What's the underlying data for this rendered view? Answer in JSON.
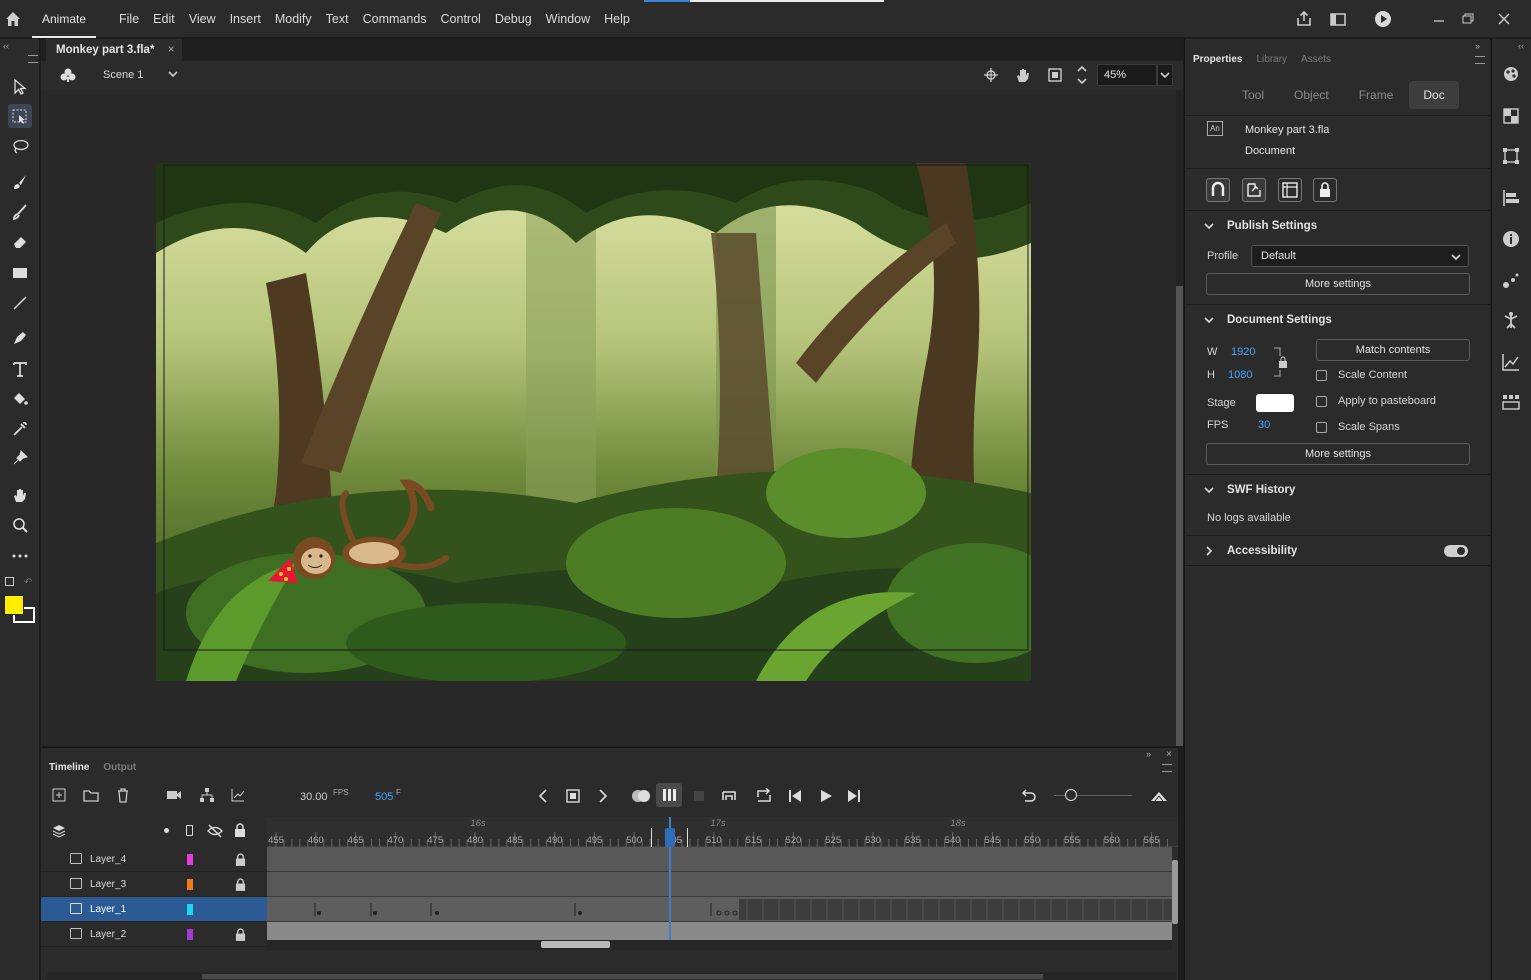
{
  "app": {
    "name": "Animate"
  },
  "menus": [
    "File",
    "Edit",
    "View",
    "Insert",
    "Modify",
    "Text",
    "Commands",
    "Control",
    "Debug",
    "Window",
    "Help"
  ],
  "document": {
    "tab_title": "Monkey part 3.fla*",
    "close": "×"
  },
  "scene": {
    "name": "Scene 1"
  },
  "zoom": {
    "value": "45%"
  },
  "timeline": {
    "tab_timeline": "Timeline",
    "tab_output": "Output",
    "fps_value": "30.00",
    "fps_unit": "FPS",
    "current_frame": "505",
    "frame_unit": "F",
    "ruler_ticks": [
      "455",
      "460",
      "465",
      "470",
      "475",
      "480",
      "485",
      "490",
      "495",
      "500",
      "505",
      "510",
      "515",
      "520",
      "525",
      "530",
      "535",
      "540",
      "545",
      "550",
      "555",
      "560",
      "565"
    ],
    "time_labels": [
      "16s",
      "17s",
      "18s"
    ],
    "layers": [
      {
        "name": "Layer_4",
        "color": "#e03ce0",
        "locked": true
      },
      {
        "name": "Layer_3",
        "color": "#f07a1c",
        "locked": true
      },
      {
        "name": "Layer_1",
        "color": "#1fd6f0",
        "locked": false,
        "selected": true
      },
      {
        "name": "Layer_2",
        "color": "#a03cd0",
        "locked": true
      }
    ]
  },
  "properties": {
    "tabs": [
      "Properties",
      "Library",
      "Assets"
    ],
    "subtabs": [
      "Tool",
      "Object",
      "Frame",
      "Doc"
    ],
    "doc_badge": "An",
    "doc_name": "Monkey part 3.fla",
    "doc_type": "Document",
    "publish": {
      "title": "Publish Settings",
      "profile_label": "Profile",
      "profile_value": "Default",
      "more": "More settings"
    },
    "docsettings": {
      "title": "Document Settings",
      "w_label": "W",
      "w_value": "1920",
      "h_label": "H",
      "h_value": "1080",
      "match": "Match contents",
      "scale_content": "Scale Content",
      "apply_pasteboard": "Apply to pasteboard",
      "scale_spans": "Scale Spans",
      "stage_label": "Stage",
      "stage_color": "#ffffff",
      "fps_label": "FPS",
      "fps_value": "30",
      "more": "More settings"
    },
    "swf": {
      "title": "SWF History",
      "empty": "No logs available"
    },
    "accessibility": {
      "title": "Accessibility"
    }
  },
  "colors": {
    "fill": "#ffee00",
    "stroke": "#e23a3a",
    "accent": "#3f80c6"
  }
}
